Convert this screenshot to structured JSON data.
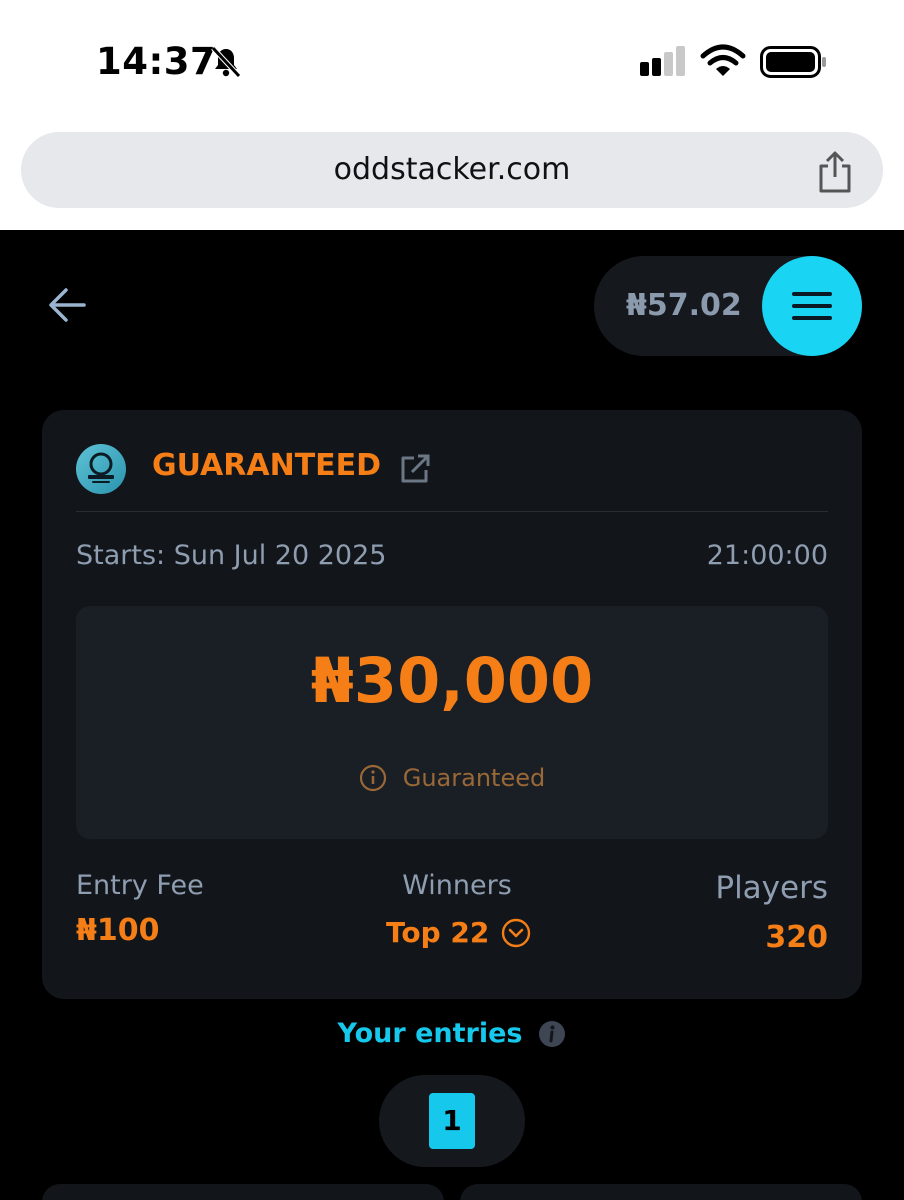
{
  "status_bar": {
    "time": "14:37",
    "icons": [
      "bell-slash-icon",
      "signal-icon",
      "wifi-icon",
      "battery-icon"
    ]
  },
  "browser": {
    "url": "oddstacker.com",
    "share_icon": "share-icon"
  },
  "header": {
    "back_icon": "arrow-left-icon",
    "balance": "₦57.02",
    "menu_icon": "hamburger-icon",
    "accent_color": "#19d4f3"
  },
  "contest": {
    "title": "GUARANTEED",
    "start_label": "Starts: Sun Jul 20 2025",
    "start_time": "21:00:00",
    "prize": "₦30,000",
    "prize_note": "Guaranteed",
    "entry_fee_label": "Entry Fee",
    "entry_fee": "₦100",
    "winners_label": "Winners",
    "winners": "Top 22",
    "players_label": "Players",
    "players": "320",
    "accent_color": "#f57e17"
  },
  "entries": {
    "title": "Your entries",
    "items": [
      "1"
    ]
  }
}
